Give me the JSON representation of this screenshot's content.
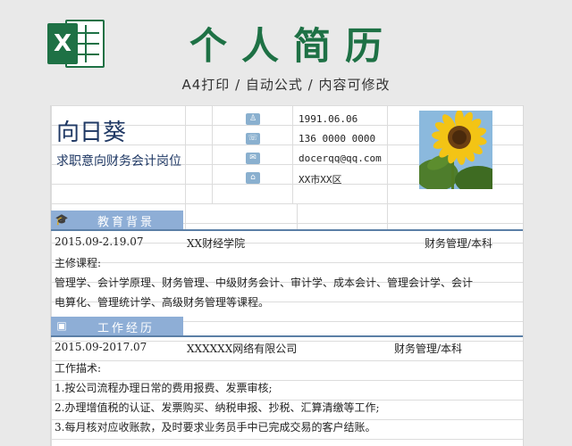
{
  "header": {
    "logo_letter": "X",
    "title": "个人简历",
    "subtitle": "A4打印 / 自动公式 / 内容可修改"
  },
  "profile": {
    "name": "向日葵",
    "objective": "求职意向财务会计岗位",
    "contacts": [
      {
        "icon": "user-icon",
        "glyph": "♙",
        "value": "1991.06.06"
      },
      {
        "icon": "phone-icon",
        "glyph": "☏",
        "value": "136 0000 0000"
      },
      {
        "icon": "mail-icon",
        "glyph": "✉",
        "value": "docerqq@qq.com"
      },
      {
        "icon": "location-icon",
        "glyph": "⌂",
        "value": "XX市XX区"
      }
    ],
    "photo_icon": "sunflower-photo"
  },
  "education": {
    "title": "教育背景",
    "icon": "graduation-cap-icon",
    "period": "2015.09-2.19.07",
    "school": "XX财经学院",
    "major": "财务管理/本科",
    "courses_label": "主修课程:",
    "courses_line1": "管理学、会计学原理、财务管理、中级财务会计、审计学、成本会计、管理会计学、会计",
    "courses_line2": "电算化、管理统计学、高级财务管理等课程。"
  },
  "work": {
    "title": "工作经历",
    "icon": "briefcase-icon",
    "period": "2015.09-2017.07",
    "company": "XXXXXX网络有限公司",
    "position": "财务管理/本科",
    "desc_label": "工作描术:",
    "items": [
      "1.按公司流程办理日常的费用报费、发票审核;",
      "2.办理增值税的认证、发票购买、纳税申报、抄税、汇算清缴等工作;",
      "3.每月核对应收账款，及时要求业务员手中已完成交易的客户结账。"
    ]
  },
  "colors": {
    "brand_green": "#1e7145",
    "navy_text": "#1f3864",
    "section_blue": "#8eaed6",
    "icon_blue": "#8ab0cf"
  }
}
